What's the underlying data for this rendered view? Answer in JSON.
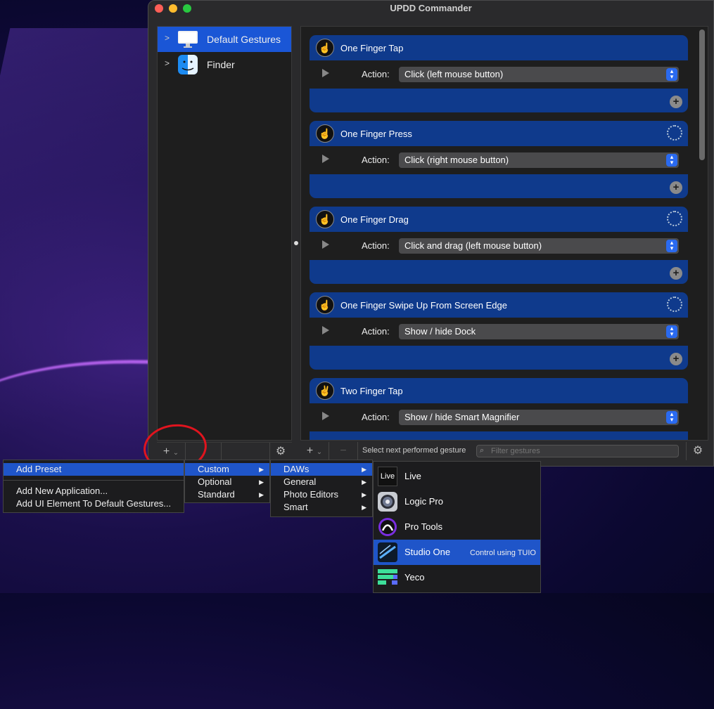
{
  "window": {
    "title": "UPDD Commander"
  },
  "sidebar": {
    "items": [
      {
        "label": "Default Gestures",
        "icon": "monitor-icon",
        "selected": true
      },
      {
        "label": "Finder",
        "icon": "finder-icon",
        "selected": false
      }
    ]
  },
  "bottom": {
    "add_symbol": "+",
    "chevron": "⌄",
    "minus_symbol": "−",
    "select_next_label": "Select next performed gesture",
    "filter_placeholder": "Filter gestures"
  },
  "gestures": [
    {
      "title": "One Finger Tap",
      "action_label": "Action:",
      "action": "Click (left mouse button)",
      "has_gear": false
    },
    {
      "title": "One Finger Press",
      "action_label": "Action:",
      "action": "Click (right mouse button)",
      "has_gear": true
    },
    {
      "title": "One Finger Drag",
      "action_label": "Action:",
      "action": "Click and drag (left mouse button)",
      "has_gear": true
    },
    {
      "title": "One Finger Swipe Up From Screen Edge",
      "action_label": "Action:",
      "action": "Show / hide Dock",
      "has_gear": true
    },
    {
      "title": "Two Finger Tap",
      "action_label": "Action:",
      "action": "Show / hide Smart Magnifier",
      "has_gear": false
    }
  ],
  "menu_main": {
    "items": [
      "Add Preset",
      "Add New Application...",
      "Add UI Element To Default Gestures..."
    ]
  },
  "menu_preset": {
    "items": [
      "Custom",
      "Optional",
      "Standard"
    ]
  },
  "menu_custom": {
    "items": [
      "DAWs",
      "General",
      "Photo Editors",
      "Smart"
    ]
  },
  "menu_daws": {
    "items": [
      {
        "label": "Live",
        "icon_text": "Live",
        "icon": "ableton-live-icon"
      },
      {
        "label": "Logic Pro",
        "icon": "logic-pro-icon"
      },
      {
        "label": "Pro Tools",
        "icon": "pro-tools-icon"
      },
      {
        "label": "Studio One",
        "icon": "studio-one-icon",
        "note": "Control using TUIO"
      },
      {
        "label": "Yeco",
        "icon": "yeco-icon"
      }
    ]
  },
  "colors": {
    "accent": "#1f55c9",
    "card": "#0f3a8c",
    "annotation": "#e0141e"
  }
}
